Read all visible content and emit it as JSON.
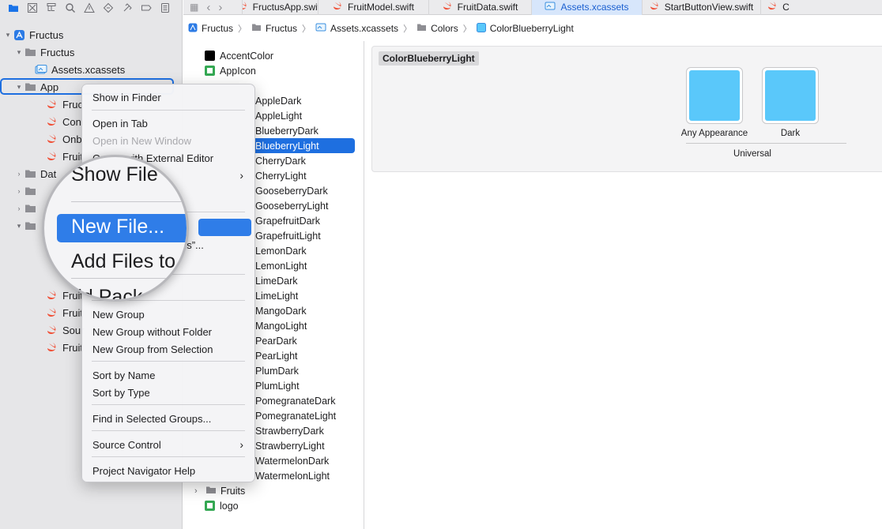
{
  "navigator": {
    "toolbar_icons": [
      "folder-icon",
      "source-control-icon",
      "hierarchy-icon",
      "find-icon",
      "issue-icon",
      "test-icon",
      "debug-icon",
      "breakpoint-icon",
      "report-icon"
    ],
    "tree": [
      {
        "label": "Fructus",
        "icon": "project-icon"
      },
      {
        "label": "Fructus",
        "icon": "folder-icon"
      },
      {
        "label": "Assets.xcassets",
        "icon": "asset-catalog-icon"
      },
      {
        "label": "App",
        "icon": "folder-icon"
      },
      {
        "label": "Fruc",
        "icon": "swift-icon"
      },
      {
        "label": "Con",
        "icon": "swift-icon"
      },
      {
        "label": "Onb",
        "icon": "swift-icon"
      },
      {
        "label": "Fruit",
        "icon": "swift-icon"
      },
      {
        "label": "Dat",
        "icon": "folder-icon"
      },
      {
        "label": "",
        "icon": "folder-icon"
      },
      {
        "label": "",
        "icon": "folder-icon"
      },
      {
        "label": "",
        "icon": "folder-icon"
      },
      {
        "label": "Fruit",
        "icon": "swift-icon"
      },
      {
        "label": "Fruit",
        "icon": "swift-icon"
      },
      {
        "label": "Sour",
        "icon": "swift-icon"
      },
      {
        "label": "Fruit",
        "icon": "swift-icon"
      }
    ]
  },
  "tabs": [
    {
      "label": "FructusApp.swift",
      "active": false
    },
    {
      "label": "FruitModel.swift",
      "active": false
    },
    {
      "label": "FruitData.swift",
      "active": false
    },
    {
      "label": "Assets.xcassets",
      "active": true
    },
    {
      "label": "StartButtonView.swift",
      "active": false
    },
    {
      "label": "C",
      "active": false
    }
  ],
  "jumpbar": [
    "Fructus",
    "Fructus",
    "Assets.xcassets",
    "Colors",
    "ColorBlueberryLight"
  ],
  "assets": {
    "top": [
      {
        "label": "AccentColor",
        "kind": "color-black"
      },
      {
        "label": "AppIcon",
        "kind": "appicon"
      }
    ],
    "colors_folder_label": "Colors",
    "colors": [
      "ColorAppleDark",
      "ColorAppleLight",
      "ColorBlueberryDark",
      "ColorBlueberryLight",
      "ColorCherryDark",
      "ColorCherryLight",
      "ColorGooseberryDark",
      "ColorGooseberryLight",
      "ColorGrapefruitDark",
      "ColorGrapefruitLight",
      "ColorLemonDark",
      "ColorLemonLight",
      "ColorLimeDark",
      "ColorLimeLight",
      "ColorMangoDark",
      "ColorMangoLight",
      "ColorPearDark",
      "ColorPearLight",
      "ColorPlumDark",
      "ColorPlumLight",
      "ColorPomegranateDark",
      "ColorPomegranateLight",
      "ColorStrawberryDark",
      "ColorStrawberryLight",
      "ColorWatermelonDark",
      "ColorWatermelonLight"
    ],
    "colors_visible": [
      "AppleDark",
      "AppleLight",
      "BlueberryDark",
      "BlueberryLight",
      "CherryDark",
      "CherryLight",
      "GooseberryDark",
      "GooseberryLight",
      "GrapefruitDark",
      "GrapefruitLight",
      "LemonDark",
      "LemonLight",
      "LimeDark",
      "LimeLight",
      "MangoDark",
      "MangoLight",
      "PearDark",
      "PearLight",
      "PlumDark",
      "PlumLight",
      "PomegranateDark",
      "PomegranateLight",
      "StrawberryDark",
      "StrawberryLight",
      "WatermelonDark",
      "WatermelonLight"
    ],
    "selected": "ColorBlueberryLight",
    "bottom": [
      {
        "label": "Fruits",
        "kind": "folder"
      },
      {
        "label": "logo",
        "kind": "image"
      }
    ]
  },
  "detail": {
    "title": "ColorBlueberryLight",
    "wells": [
      {
        "label": "Any Appearance",
        "color": "#5ac8fa"
      },
      {
        "label": "Dark",
        "color": "#5ac8fa"
      }
    ],
    "group_label": "Universal"
  },
  "context_menu": {
    "items": [
      {
        "label": "Show in Finder"
      },
      {
        "sep": true
      },
      {
        "label": "Open in Tab"
      },
      {
        "label": "Open in New Window",
        "disabled": true
      },
      {
        "label": "Open with External Editor"
      },
      {
        "label": "Show File Inspector",
        "submenu": true
      },
      {
        "sep": true
      },
      {
        "label": "New File..."
      },
      {
        "label": "Add Files to \"Fructus\"..."
      },
      {
        "sep": true
      },
      {
        "label": "Add Packages..."
      },
      {
        "sep": true
      },
      {
        "label": "New Group"
      },
      {
        "label": "New Group without Folder"
      },
      {
        "label": "New Group from Selection"
      },
      {
        "sep": true
      },
      {
        "label": "Sort by Name"
      },
      {
        "label": "Sort by Type"
      },
      {
        "sep": true
      },
      {
        "label": "Find in Selected Groups..."
      },
      {
        "sep": true
      },
      {
        "label": "Source Control",
        "submenu": true
      },
      {
        "sep": true
      },
      {
        "label": "Project Navigator Help"
      }
    ],
    "visible_labels": {
      "show_in_finder": "Show in Finder",
      "open_in_tab": "Open in Tab",
      "open_in_new_window": "Open in New Window",
      "open_external_fragment": "with External Editor",
      "open_external_prefix": "O",
      "add_files_fragment": "us”...",
      "new_group": "New Group",
      "new_group_without_folder": "New Group without Folder",
      "new_group_from_selection": "New Group from Selection",
      "sort_by_name": "Sort by Name",
      "sort_by_type": "Sort by Type",
      "find_in_selected_groups": "Find in Selected Groups...",
      "source_control": "Source Control",
      "project_navigator_help": "Project Navigator Help"
    }
  },
  "magnifier": {
    "items": [
      "Show File",
      "New File...",
      "Add Files to",
      "dd Pack"
    ],
    "highlight": "New File..."
  },
  "colors": {
    "accent": "#1e6fe0",
    "swift": "#f05138",
    "asset_blue": "#5ac8fa"
  }
}
